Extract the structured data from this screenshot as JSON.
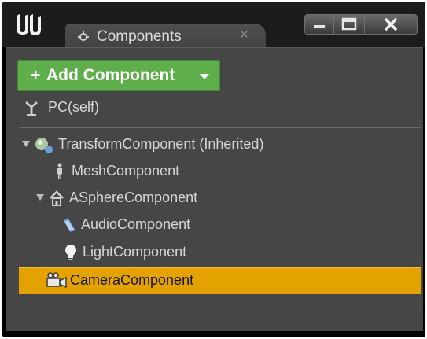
{
  "window": {
    "tab_title": "Components",
    "tab_close": "×",
    "buttons": [
      "minimize-icon",
      "maximize-icon",
      "close-icon"
    ]
  },
  "toolbar": {
    "add_plus": "+",
    "add_label": "Add Component"
  },
  "tree": {
    "self": {
      "label": "PC(self)",
      "icon": "actor-icon"
    },
    "items": [
      {
        "label": "TransformComponent (Inherited)",
        "icon": "transform-icon",
        "expanded": true
      },
      {
        "label": "MeshComponent",
        "icon": "mesh-icon"
      },
      {
        "label": "ASphereComponent",
        "icon": "sphere-icon",
        "expanded": true
      },
      {
        "label": "AudioComponent",
        "icon": "audio-icon"
      },
      {
        "label": "LightComponent",
        "icon": "light-icon"
      },
      {
        "label": "CameraComponent",
        "icon": "camera-icon",
        "selected": true
      }
    ]
  },
  "colors": {
    "accent_green": "#5eae4c",
    "selection": "#e3a200",
    "panel": "#464646",
    "chrome": "#1c1c1c"
  }
}
